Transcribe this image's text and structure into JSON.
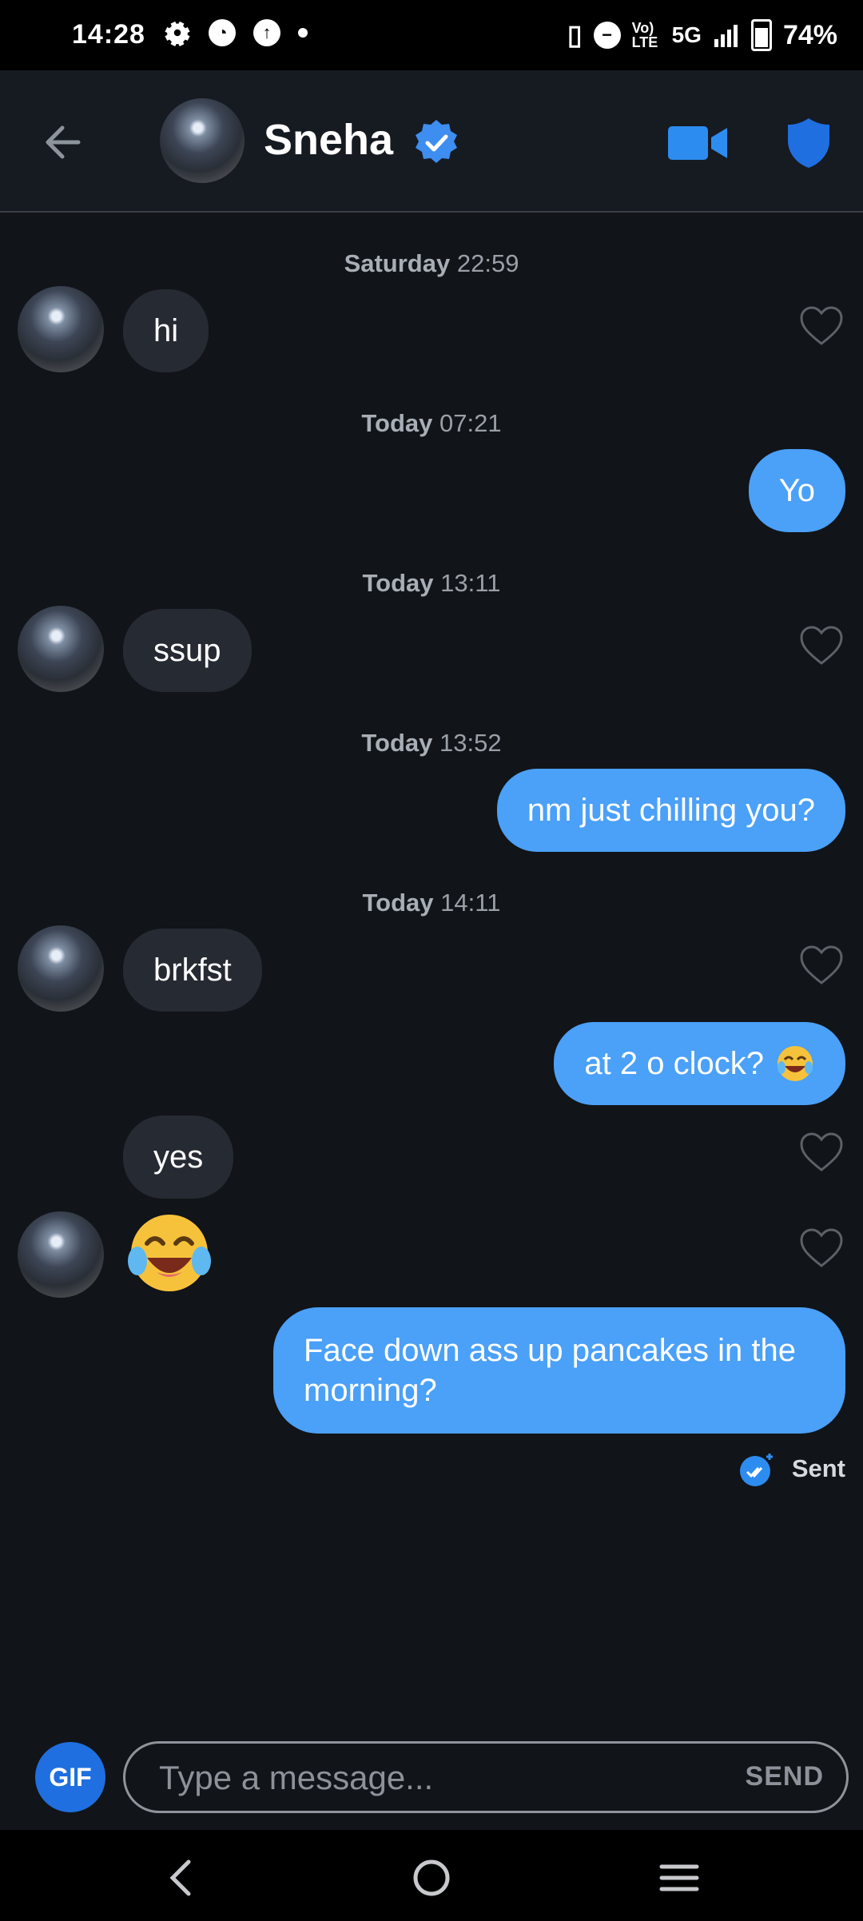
{
  "status_bar": {
    "time": "14:28",
    "network": "5G",
    "volte": "Vo) LTE",
    "battery": "74%"
  },
  "header": {
    "contact_name": "Sneha",
    "verified": true
  },
  "messages": [
    {
      "type": "timestamp",
      "day": "Saturday",
      "time": "22:59"
    },
    {
      "type": "incoming",
      "text": "hi",
      "avatar": true
    },
    {
      "type": "timestamp",
      "day": "Today",
      "time": "07:21"
    },
    {
      "type": "outgoing",
      "text": "Yo"
    },
    {
      "type": "timestamp",
      "day": "Today",
      "time": "13:11"
    },
    {
      "type": "incoming",
      "text": "ssup",
      "avatar": true
    },
    {
      "type": "timestamp",
      "day": "Today",
      "time": "13:52"
    },
    {
      "type": "outgoing",
      "text": "nm just chilling you?"
    },
    {
      "type": "timestamp",
      "day": "Today",
      "time": "14:11"
    },
    {
      "type": "incoming",
      "text": "brkfst",
      "avatar": true
    },
    {
      "type": "outgoing",
      "text": "at 2 o clock?",
      "emoji": "tears-of-joy"
    },
    {
      "type": "incoming",
      "text": "yes",
      "avatar": false
    },
    {
      "type": "incoming_emoji",
      "emoji": "tears-of-joy",
      "avatar": true
    },
    {
      "type": "outgoing",
      "text_line1": "Face down ass up pancakes in the",
      "text_line2": "morning?"
    }
  ],
  "sent_status": "Sent",
  "composer": {
    "gif_label": "GIF",
    "placeholder": "Type a message...",
    "send_label": "SEND"
  },
  "colors": {
    "background": "#111418",
    "incoming_bubble": "#262a33",
    "outgoing_bubble": "#4ba0f8",
    "accent": "#2d8cf0"
  }
}
